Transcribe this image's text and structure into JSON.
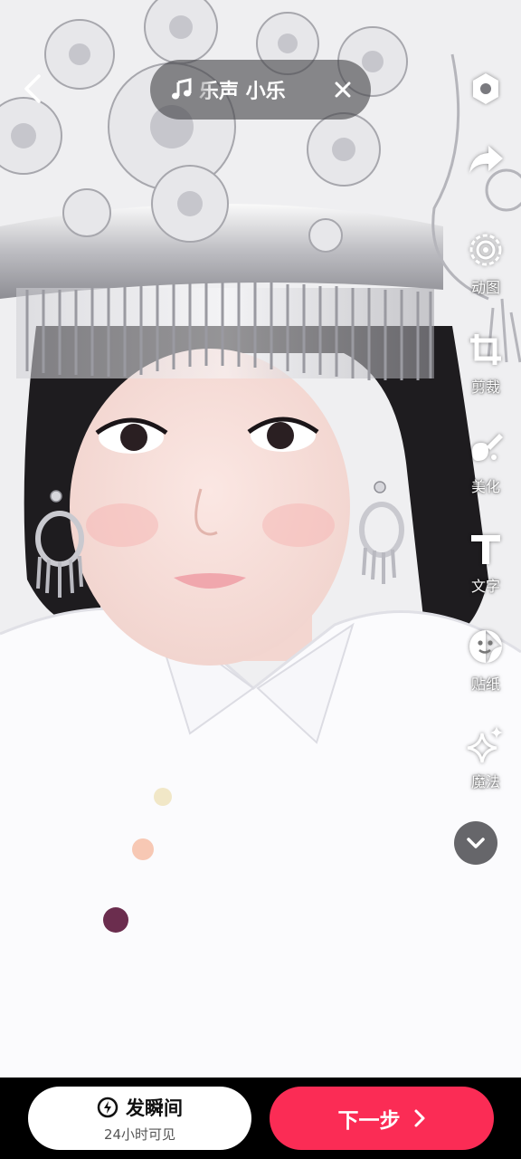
{
  "music": {
    "track_text": "乐声 小乐",
    "icon": "music-note-icon",
    "close_icon": "close-icon"
  },
  "toolbar": {
    "settings_icon": "gear-icon",
    "share_icon": "share-icon",
    "items": [
      {
        "label": "动图",
        "icon": "animated-image-icon"
      },
      {
        "label": "剪裁",
        "icon": "crop-icon"
      },
      {
        "label": "美化",
        "icon": "beautify-icon"
      },
      {
        "label": "文字",
        "icon": "text-icon"
      },
      {
        "label": "贴纸",
        "icon": "sticker-icon"
      },
      {
        "label": "魔法",
        "icon": "magic-sparkle-icon"
      }
    ],
    "collapse_icon": "chevron-down-icon"
  },
  "bottom": {
    "moment_label": "发瞬间",
    "moment_sub": "24小时可见",
    "next_label": "下一步"
  },
  "colors": {
    "accent": "#fb2c55",
    "pill_bg": "#464648",
    "bar_bg": "#000000"
  }
}
